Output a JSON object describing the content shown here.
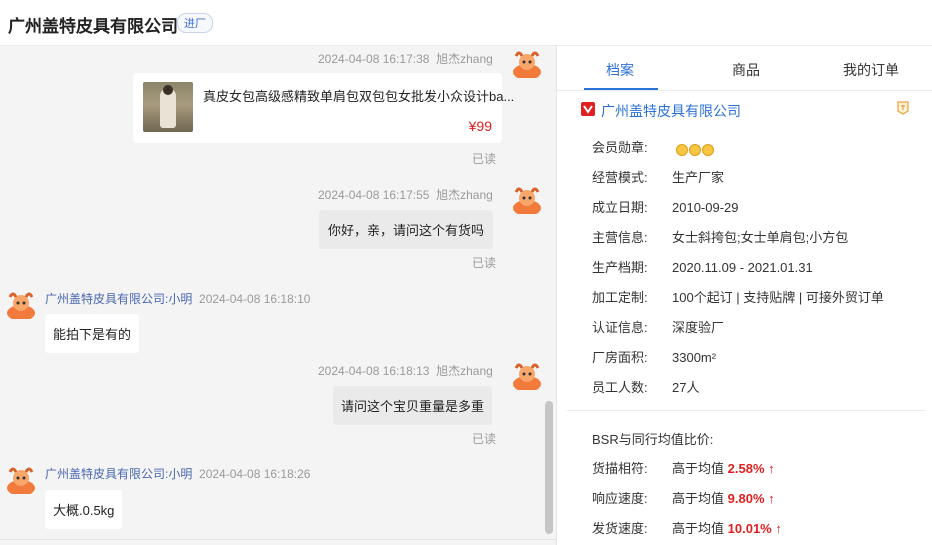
{
  "header": {
    "shop_name": "广州盖特皮具有限公司",
    "badge": "进厂"
  },
  "chat": {
    "messages": [
      {
        "time": "2024-04-08 16:17:38",
        "sender": "旭杰zhang",
        "read": "已读",
        "product": {
          "title": "真皮女包高级感精致单肩包双包包女批发小众设计ba...",
          "price": "¥99"
        }
      },
      {
        "time": "2024-04-08 16:17:55",
        "sender": "旭杰zhang",
        "text": "你好，亲，请问这个有货吗",
        "read": "已读"
      },
      {
        "time": "2024-04-08 16:18:10",
        "sender": "广州盖特皮具有限公司:小明",
        "text": "能拍下是有的"
      },
      {
        "time": "2024-04-08 16:18:13",
        "sender": "旭杰zhang",
        "text": "请问这个宝贝重量是多重",
        "read": "已读"
      },
      {
        "time": "2024-04-08 16:18:26",
        "sender": "广州盖特皮具有限公司:小明",
        "text": "大概.0.5kg"
      }
    ],
    "collapse_glyph": "»"
  },
  "panel": {
    "tabs": [
      "档案",
      "商品",
      "我的订单"
    ],
    "active_tab": "档案",
    "shop_name": "广州盖特皮具有限公司",
    "info": [
      {
        "label": "会员勋章:",
        "value": ""
      },
      {
        "label": "经营模式:",
        "value": "生产厂家"
      },
      {
        "label": "成立日期:",
        "value": "2010-09-29"
      },
      {
        "label": "主营信息:",
        "value": "女士斜挎包;女士单肩包;小方包"
      },
      {
        "label": "生产档期:",
        "value": "2020.11.09 - 2021.01.31"
      },
      {
        "label": "加工定制:",
        "value": "100个起订 | 支持贴牌 | 可接外贸订单"
      },
      {
        "label": "认证信息:",
        "value": "深度验厂"
      },
      {
        "label": "厂房面积:",
        "value": "3300m²"
      },
      {
        "label": "员工人数:",
        "value": "27人"
      }
    ],
    "medal_count": 3,
    "bsr": {
      "title": "BSR与同行均值比价:",
      "items": [
        {
          "label": "货描相符:",
          "prefix": "高于均值",
          "value": "2.58%",
          "arrow": "↑"
        },
        {
          "label": "响应速度:",
          "prefix": "高于均值",
          "value": "9.80%",
          "arrow": "↑"
        },
        {
          "label": "发货速度:",
          "prefix": "高于均值",
          "value": "10.01%",
          "arrow": "↑"
        }
      ]
    },
    "colors": {
      "accent": "#2a72d8",
      "highlight": "#e02020"
    },
    "icons": [
      "shop-icon",
      "side-badge-icon",
      "medal-icon"
    ]
  }
}
